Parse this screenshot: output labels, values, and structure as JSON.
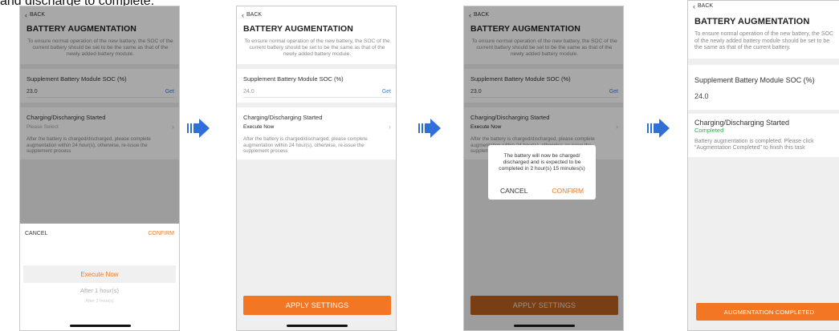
{
  "caption": "and discharge to complete.",
  "accent_orange": "#f37624",
  "link_blue": "#3d7ee8",
  "status_green": "#2fae44",
  "arrow_icon": "right-arrow-icon",
  "common": {
    "back": "BACK",
    "title": "BATTERY AUGMENTATION",
    "desc": "To ensure normal operation of the new battery, the SOC of the current battery should be set to be the same as that of the newly added battery module.",
    "soc_label": "Supplement Battery Module SOC (%)",
    "get": "Get",
    "charging_label": "Charging/Discharging Started",
    "note": "After the battery is charged/discharged, please complete augmentation within 24 hour(s), otherwise, re-issue the supplement process"
  },
  "screen1": {
    "soc_value": "23.0",
    "charging_value": "Please Select",
    "picker": {
      "cancel": "CANCEL",
      "confirm": "CONFIRM",
      "selected": "Execute Now",
      "option_2": "After 1 hour(s)",
      "option_3": "After 2 hour(s)"
    }
  },
  "screen2": {
    "soc_value": "24.0",
    "charging_value": "Execute Now",
    "apply": "APPLY SETTINGS"
  },
  "screen3": {
    "soc_value": "23.0",
    "charging_value": "Execute Now",
    "dialog": {
      "message": "The battery will now be charged/ discharged and is expected to be completed in 2 hour(s) 15 minutes(s)",
      "cancel": "CANCEL",
      "confirm": "CONFIRM"
    },
    "apply": "APPLY SETTINGS"
  },
  "screen4": {
    "back": "BACK",
    "title": "BATTERY AUGMENTATION",
    "desc": "To ensure normal operation of the new battery, the SOC of the newly added battery module should be set to be the same as that of the current battery.",
    "soc_value": "24.0",
    "charging_value": "Completed",
    "note": "Battery augmentation is completed. Please click \"Augmentation Completed\" to finish this task",
    "button": "AUGMENTATION COMPLETED"
  }
}
